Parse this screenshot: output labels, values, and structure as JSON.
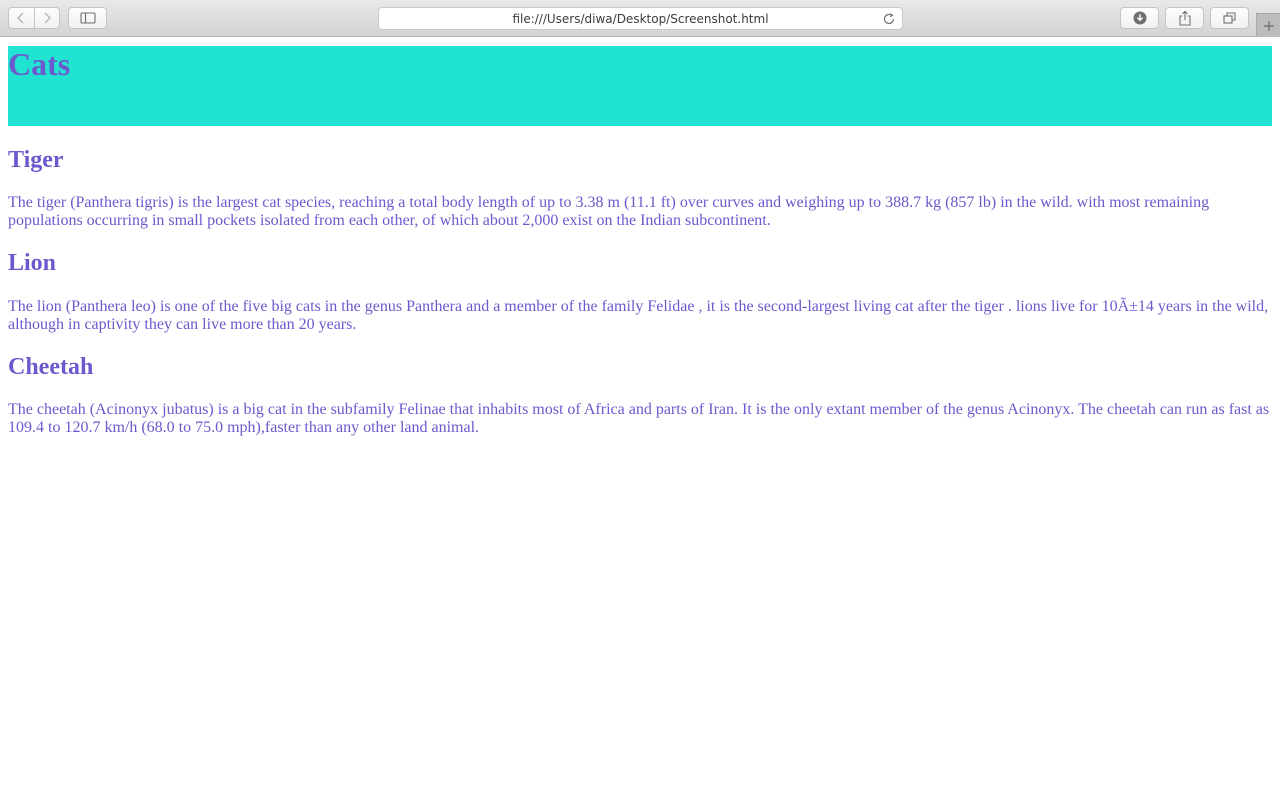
{
  "browser": {
    "url": "file:///Users/diwa/Desktop/Screenshot.html"
  },
  "page": {
    "title": "Cats",
    "sections": [
      {
        "heading": "Tiger",
        "text": "The tiger (Panthera tigris) is the largest cat species, reaching a total body length of up to 3.38 m (11.1 ft) over curves and weighing up to 388.7 kg (857 lb) in the wild. with most remaining populations occurring in small pockets isolated from each other, of which about 2,000 exist on the Indian subcontinent."
      },
      {
        "heading": "Lion",
        "text": "The lion (Panthera leo) is one of the five big cats in the genus Panthera and a member of the family Felidae , it is the second-largest living cat after the tiger . lions live for 10Ã±14 years in the wild, although in captivity they can live more than 20 years."
      },
      {
        "heading": "Cheetah",
        "text": "The cheetah (Acinonyx jubatus) is a big cat in the subfamily Felinae that inhabits most of Africa and parts of Iran. It is the only extant member of the genus Acinonyx. The cheetah can run as fast as 109.4 to 120.7 km/h (68.0 to 75.0 mph),faster than any other land animal."
      }
    ]
  },
  "colors": {
    "banner": "#20e3d2",
    "text": "#6a5acd"
  },
  "icons": {
    "back": "chevron-left-icon",
    "forward": "chevron-right-icon",
    "sidebar": "sidebar-icon",
    "reload": "reload-icon",
    "downloads": "download-icon",
    "share": "share-icon",
    "tabs": "tabs-icon",
    "new_tab": "plus-icon"
  }
}
